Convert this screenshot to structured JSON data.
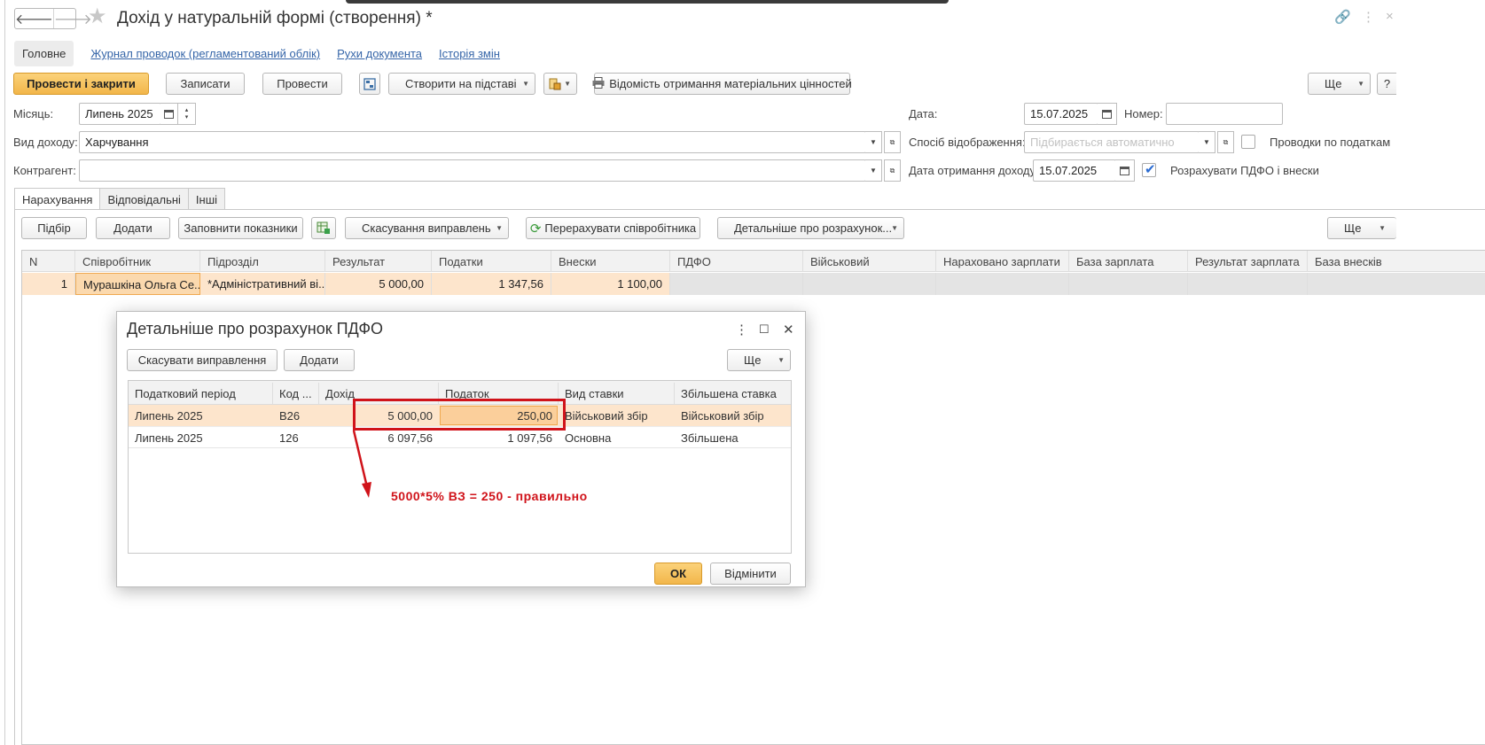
{
  "window": {
    "title": "Дохід у натуральній формі (створення) *",
    "back_glyph": "🡐",
    "forward_glyph": "🡒"
  },
  "nav_tabs": {
    "active": "Головне",
    "links": [
      "Журнал проводок (регламентований облік)",
      "Рухи документа",
      "Історія змін"
    ]
  },
  "toolbar": {
    "post_close": "Провести і закрити",
    "save": "Записати",
    "post": "Провести",
    "create_based": "Створити на підставі",
    "print_report": "Відомість отримання матеріальних цінностей",
    "more": "Ще",
    "help": "?"
  },
  "form": {
    "month_label": "Місяць:",
    "month_value": "Липень 2025",
    "income_type_label": "Вид доходу:",
    "income_type_value": "Харчування",
    "counterparty_label": "Контрагент:",
    "counterparty_value": "",
    "date_label": "Дата:",
    "date_value": "15.07.2025",
    "number_label": "Номер:",
    "number_value": "",
    "display_method_label": "Спосіб відображення:",
    "display_method_placeholder": "Підбирається автоматично",
    "tax_postings_label": "Проводки по податкам",
    "tax_postings_checked": false,
    "income_date_label": "Дата отримання доходу:",
    "income_date_value": "15.07.2025",
    "calc_pdfo_label": "Розрахувати ПДФО і внески",
    "calc_pdfo_checked": true
  },
  "sub_tabs": [
    "Нарахування",
    "Відповідальні",
    "Інші"
  ],
  "accrual_toolbar": {
    "select": "Підбір",
    "add": "Додати",
    "fill": "Заповнити показники",
    "cancel_corrections": "Скасування виправлень",
    "recalc": "Перерахувати співробітника",
    "details": "Детальніше про розрахунок...",
    "more": "Ще"
  },
  "accrual_table": {
    "columns": [
      "N",
      "Співробітник",
      "Підрозділ",
      "Результат",
      "Податки",
      "Внески",
      "ПДФО",
      "Військовий",
      "Нараховано зарплати",
      "База зарплата",
      "Результат зарплата",
      "База внесків"
    ],
    "rows": [
      {
        "n": "1",
        "employee": "Мурашкіна Ольга Се...",
        "department": "*Адміністративний ві...",
        "result": "5 000,00",
        "taxes": "1 347,56",
        "contributions": "1 100,00",
        "pdfo": "",
        "military": "",
        "salary_accrued": "",
        "salary_base": "",
        "salary_result": "",
        "contrib_base": ""
      }
    ]
  },
  "dialog": {
    "title": "Детальніше про розрахунок ПДФО",
    "cancel_corrections": "Скасувати виправлення",
    "add": "Додати",
    "more": "Ще",
    "columns": [
      "Податковий період",
      "Код ...",
      "Дохід",
      "Податок",
      "Вид ставки",
      "Збільшена ставка"
    ],
    "rows": [
      {
        "period": "Липень 2025",
        "code": "В26",
        "income": "5 000,00",
        "tax": "250,00",
        "rate_type": "Військовий збір",
        "increased_rate": "Військовий збір"
      },
      {
        "period": "Липень 2025",
        "code": "126",
        "income": "6 097,56",
        "tax": "1 097,56",
        "rate_type": "Основна",
        "increased_rate": "Збільшена"
      }
    ],
    "ok": "ОК",
    "cancel": "Відмінити",
    "annotation": "5000*5% ВЗ = 250 - правильно"
  },
  "colors": {
    "primary_button": "#f2b64a",
    "selected_row": "#fde5cc",
    "selected_cell": "#fbcf9b",
    "link": "#3565a8",
    "annotation_red": "#d0131a"
  }
}
